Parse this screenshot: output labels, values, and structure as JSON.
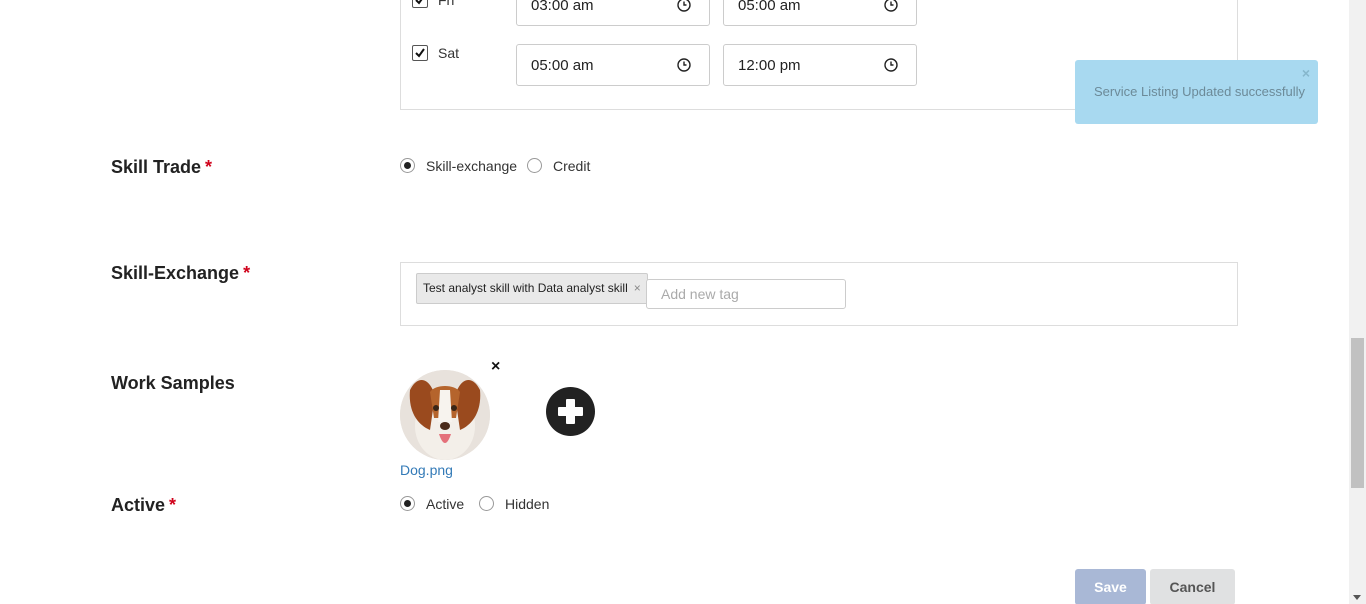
{
  "schedule": {
    "rows": [
      {
        "day": "Fri",
        "checked": true,
        "start": "03:00 am",
        "end": "05:00 am"
      },
      {
        "day": "Sat",
        "checked": true,
        "start": "05:00 am",
        "end": "12:00 pm"
      }
    ]
  },
  "skill_trade": {
    "label": "Skill Trade",
    "required": "*",
    "options": [
      {
        "label": "Skill-exchange",
        "selected": true
      },
      {
        "label": "Credit",
        "selected": false
      }
    ]
  },
  "skill_exchange": {
    "label": "Skill-Exchange",
    "required": "*",
    "tags": [
      {
        "label": "Test analyst skill with Data analyst skill",
        "remove": "×"
      }
    ],
    "input_placeholder": "Add new tag"
  },
  "work_samples": {
    "label": "Work Samples",
    "remove": "×",
    "files": [
      {
        "name": "Dog.png"
      }
    ]
  },
  "active": {
    "label": "Active",
    "required": "*",
    "options": [
      {
        "label": "Active",
        "selected": true
      },
      {
        "label": "Hidden",
        "selected": false
      }
    ]
  },
  "actions": {
    "save_label": "Save",
    "cancel_label": "Cancel"
  },
  "toast": {
    "message": "Service Listing Updated successfully",
    "close": "×"
  },
  "colors": {
    "required": "#d0021b",
    "link": "#337ab7",
    "save_button": "#a9b8d6",
    "toast_bg": "#a8d9f0"
  }
}
